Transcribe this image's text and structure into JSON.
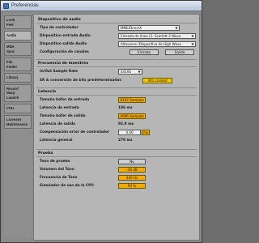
{
  "window": {
    "title": "Preferencias"
  },
  "sidebar": {
    "tabs": [
      {
        "lines": [
          "Look",
          "Feel"
        ]
      },
      {
        "lines": [
          "Audio"
        ]
      },
      {
        "lines": [
          "MIDI",
          "Sync"
        ]
      },
      {
        "lines": [
          "File",
          "Folder"
        ]
      },
      {
        "lines": [
          "Library"
        ]
      },
      {
        "lines": [
          "Record",
          "Warp",
          "Launch"
        ]
      },
      {
        "lines": [
          "CPU"
        ]
      },
      {
        "lines": [
          "Licenses",
          "Maintenance"
        ]
      }
    ],
    "active_index": 1
  },
  "audio_device": {
    "section_title": "Dispositivo de audio",
    "driver_type_label": "Tipo de controlador",
    "driver_type_value": "MME/DirectX",
    "input_device_label": "Dispositivo entrada Audio",
    "input_device_value": "Entrada de línea (2- Scarlett 2 Wave",
    "output_device_label": "Dispositivo salida Audio",
    "output_device_value": "Altavoces (Dispositivo de High Wave",
    "channel_config_label": "Configuración de canales",
    "input_button": "Entrada",
    "output_button": "Salida"
  },
  "sample_rate": {
    "section_title": "Frecuencia de muestreo",
    "in_out_label": "In/Out Sample Rate",
    "in_out_value": "44100",
    "src_label": "SR & conversión de bits predeterminadas",
    "src_value": "Alta calidad"
  },
  "latency": {
    "section_title": "Latencia",
    "input_buffer_label": "Tamaño búfer de entrada",
    "input_buffer_value": "8192 Samples",
    "input_latency_label": "Latencia de entrada",
    "input_latency_value": "186 ms",
    "output_buffer_label": "Tamaño búfer de salida",
    "output_buffer_value": "4096 Samples",
    "output_latency_label": "Latencia de salida",
    "output_latency_value": "92.9 ms",
    "comp_label": "Compensación error de controlador",
    "comp_value": "0.00",
    "comp_unit": "ms",
    "overall_label": "Latencia general",
    "overall_value": "279 ms"
  },
  "test": {
    "section_title": "Prueba",
    "tone_label": "Tono de prueba",
    "tone_value": "No",
    "volume_label": "Volumen del Tono",
    "volume_value": "-36 dB",
    "freq_label": "Frecuencia de Tono",
    "freq_value": "440 Hz",
    "cpu_label": "Simulador de uso de la CPU",
    "cpu_value": "50 %"
  },
  "colors": {
    "accent_yellow": "#f2c400",
    "accent_orange": "#f2a900"
  }
}
